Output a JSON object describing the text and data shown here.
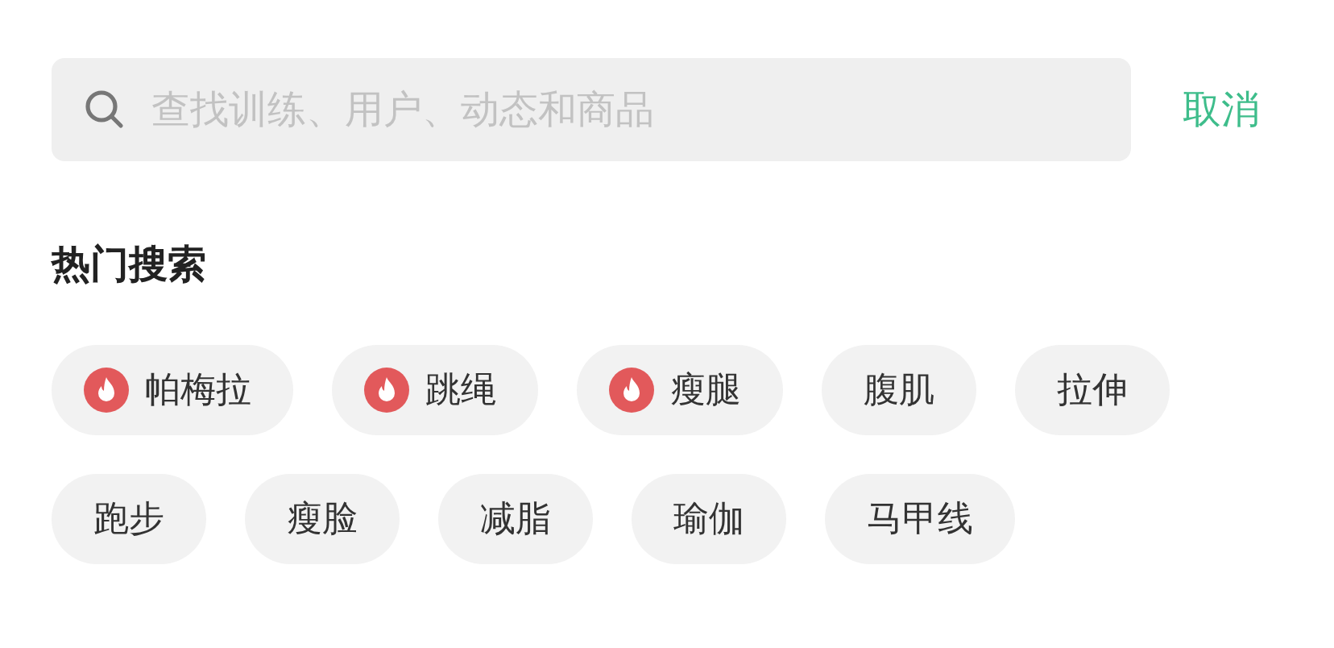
{
  "search": {
    "placeholder": "查找训练、用户、动态和商品"
  },
  "cancel": "取消",
  "hot_section": {
    "title": "热门搜索",
    "items": [
      {
        "label": "帕梅拉",
        "hot": true
      },
      {
        "label": "跳绳",
        "hot": true
      },
      {
        "label": "瘦腿",
        "hot": true
      },
      {
        "label": "腹肌",
        "hot": false
      },
      {
        "label": "拉伸",
        "hot": false
      },
      {
        "label": "跑步",
        "hot": false
      },
      {
        "label": "瘦脸",
        "hot": false
      },
      {
        "label": "减脂",
        "hot": false
      },
      {
        "label": "瑜伽",
        "hot": false
      },
      {
        "label": "马甲线",
        "hot": false
      }
    ]
  }
}
